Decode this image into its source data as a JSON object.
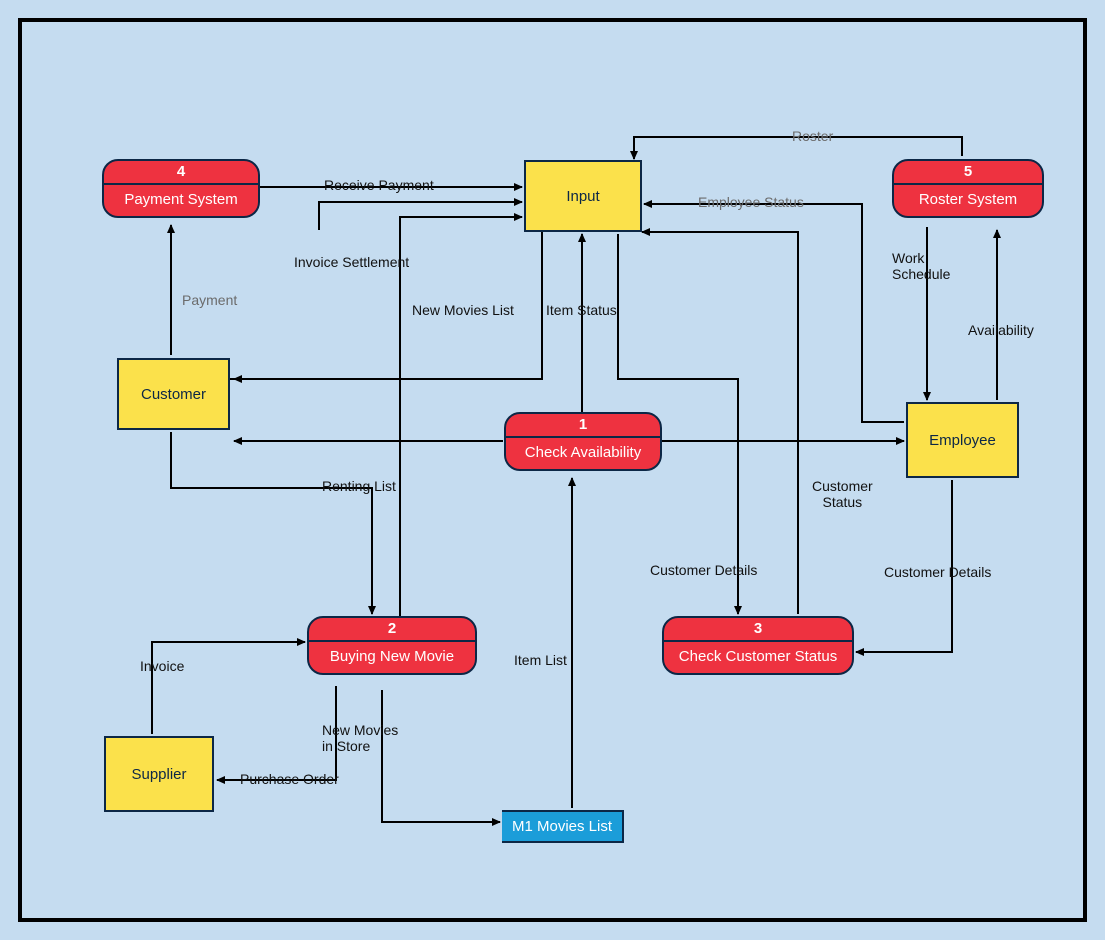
{
  "processes": {
    "p1": {
      "num": "1",
      "title": "Check Availability"
    },
    "p2": {
      "num": "2",
      "title": "Buying New Movie"
    },
    "p3": {
      "num": "3",
      "title": "Check Customer Status"
    },
    "p4": {
      "num": "4",
      "title": "Payment System"
    },
    "p5": {
      "num": "5",
      "title": "Roster System"
    }
  },
  "entities": {
    "customer": "Customer",
    "supplier": "Supplier",
    "employee": "Employee",
    "input": "Input"
  },
  "stores": {
    "movies": "M1 Movies List"
  },
  "labels": {
    "receive_payment": "Receive Payment",
    "payment": "Payment",
    "invoice_settlement": "Invoice Settlement",
    "new_movies_list": "New Movies List",
    "item_status": "Item Status",
    "renting_list": "Renting List",
    "invoice": "Invoice",
    "purchase_order": "Purchase Order",
    "new_movies_in_store": "New Movies\nin Store",
    "item_list": "Item List",
    "customer_details_a": "Customer Details",
    "customer_details_b": "Customer Details",
    "customer_status": "Customer\nStatus",
    "employee_status": "Employee Status",
    "roster": "Roster",
    "work_schedule": "Work\nSchedule",
    "availability": "Availability"
  }
}
